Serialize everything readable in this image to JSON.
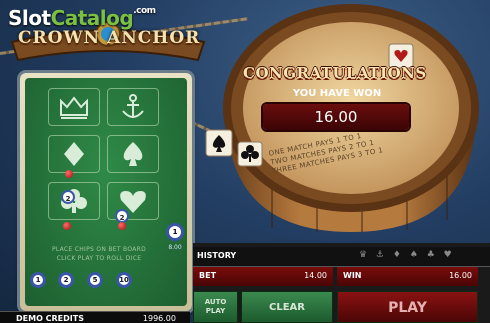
{
  "watermark": {
    "slot": "Slot",
    "catalog": "Catalog",
    "com": ".com"
  },
  "logo": {
    "title": "CROWN ANCHOR"
  },
  "popup": {
    "title": "CONGRATULATIONS",
    "subtitle": "YOU HAVE WON",
    "amount": "16.00"
  },
  "pays": {
    "line1": "ONE MATCH PAYS 1 TO 1",
    "line2": "TWO MATCHES PAYS 2 TO 1",
    "line3": "THREE MATCHES PAYS 3 TO 1"
  },
  "board": {
    "symbols": [
      "crown",
      "anchor",
      "diamond",
      "spade",
      "club",
      "heart"
    ],
    "instructions_line1": "PLACE CHIPS ON BET BOARD",
    "instructions_line2": "CLICK PLAY TO ROLL DICE",
    "bet_chips": [
      {
        "symbol": "club",
        "value": "2"
      },
      {
        "symbol": "heart",
        "value": "2"
      }
    ],
    "total_chip": "1",
    "total_value": "8.00"
  },
  "chip_denominations": [
    "1",
    "2",
    "5",
    "10"
  ],
  "panel": {
    "history_label": "HISTORY",
    "bet_label": "BET",
    "bet_value": "14.00",
    "win_label": "WIN",
    "win_value": "16.00",
    "autoplay_line1": "AUTO",
    "autoplay_line2": "PLAY",
    "clear_label": "CLEAR",
    "play_label": "PLAY"
  },
  "credits": {
    "label": "DEMO CREDITS",
    "value": "1996.00"
  },
  "colors": {
    "felt": "#2f8a47",
    "accent_red": "#6a0d0d",
    "chip_blue": "#3956a6"
  }
}
